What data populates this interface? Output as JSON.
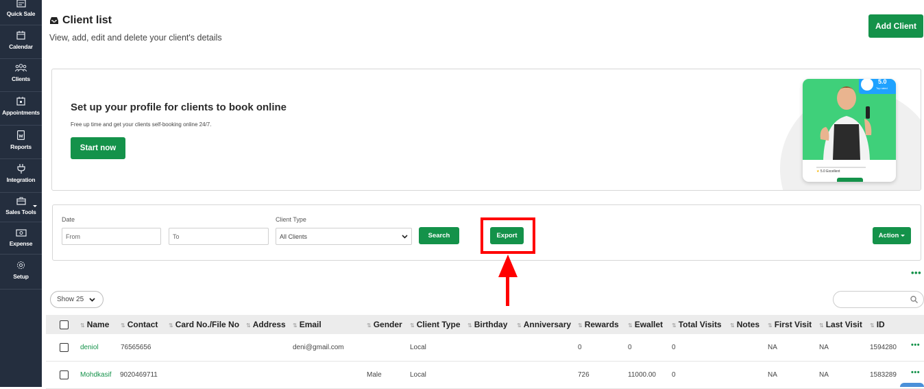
{
  "sidebar": {
    "items": [
      {
        "label": "Quick Sale",
        "icon": "receipt-icon"
      },
      {
        "label": "Calendar",
        "icon": "calendar-icon"
      },
      {
        "label": "Clients",
        "icon": "clients-icon"
      },
      {
        "label": "Appointments",
        "icon": "appointments-icon"
      },
      {
        "label": "Reports",
        "icon": "reports-icon"
      },
      {
        "label": "Integration",
        "icon": "plug-icon"
      },
      {
        "label": "Sales Tools",
        "icon": "briefcase-icon"
      },
      {
        "label": "Expense",
        "icon": "money-icon"
      },
      {
        "label": "Setup",
        "icon": "gear-icon"
      }
    ]
  },
  "header": {
    "title": "Client list",
    "subtitle": "View, add, edit and delete your client's details",
    "add_button": "Add Client"
  },
  "banner": {
    "title": "Set up your profile for clients to book online",
    "subtitle": "Free up time and get your clients self-booking online 24/7.",
    "button": "Start now",
    "rating": "5.0",
    "rating_sub": "Top rated",
    "review": "5.0 Excellent"
  },
  "filters": {
    "date_label": "Date",
    "from_placeholder": "From",
    "to_placeholder": "To",
    "client_type_label": "Client Type",
    "client_type_value": "All Clients",
    "search_button": "Search",
    "export_button": "Export",
    "action_button": "Action"
  },
  "table": {
    "show_label": "Show",
    "show_value": "25",
    "columns": [
      "Name",
      "Contact",
      "Card No./File No",
      "Address",
      "Email",
      "Gender",
      "Client Type",
      "Birthday",
      "Anniversary",
      "Rewards",
      "Ewallet",
      "Total Visits",
      "Notes",
      "First Visit",
      "Last Visit",
      "ID"
    ],
    "rows": [
      {
        "name": "deniol",
        "contact": "76565656",
        "card": "",
        "address": "",
        "email": "deni@gmail.com",
        "gender": "",
        "client_type": "Local",
        "birthday": "",
        "anniversary": "",
        "rewards": "0",
        "ewallet": "0",
        "total_visits": "0",
        "notes": "",
        "first_visit": "NA",
        "last_visit": "NA",
        "id": "1594280"
      },
      {
        "name": "Mohdkasif",
        "contact": "9020469711",
        "card": "",
        "address": "",
        "email": "",
        "gender": "Male",
        "client_type": "Local",
        "birthday": "",
        "anniversary": "",
        "rewards": "726",
        "ewallet": "11000.00",
        "total_visits": "0",
        "notes": "",
        "first_visit": "NA",
        "last_visit": "NA",
        "id": "1583289"
      }
    ]
  },
  "colors": {
    "sidebar_bg": "#242e3e",
    "brand_green": "#14924a",
    "highlight_red": "#ff0000"
  }
}
